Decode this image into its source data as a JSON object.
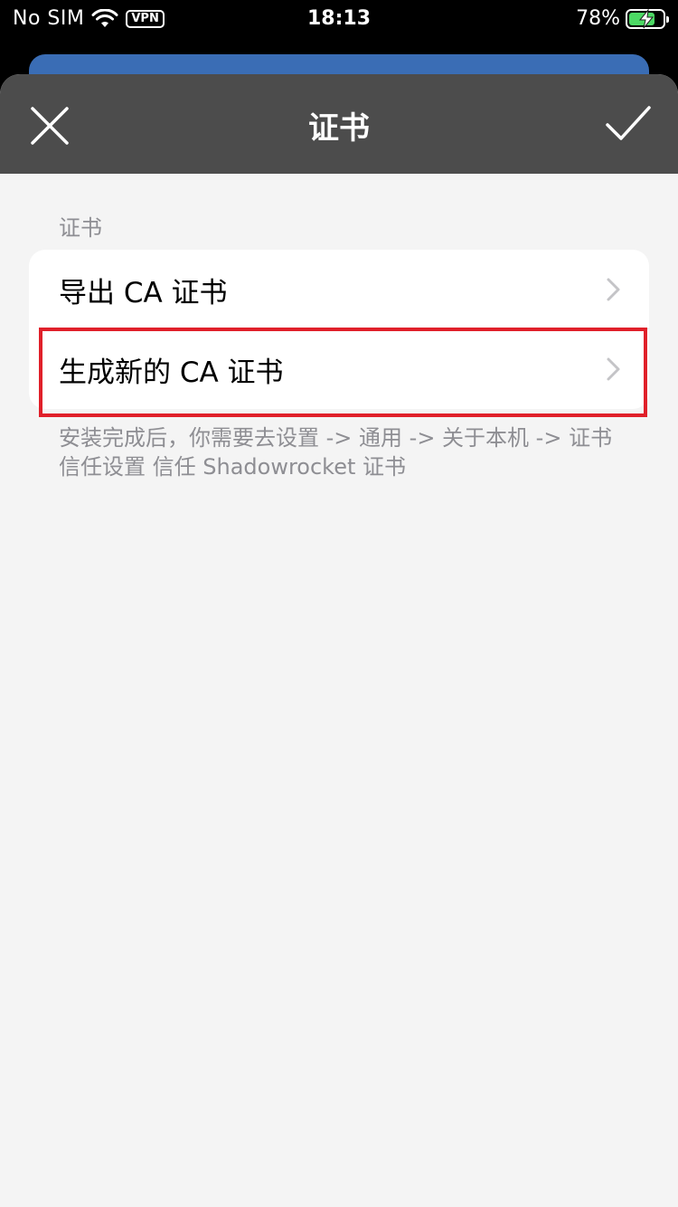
{
  "status_bar": {
    "carrier": "No SIM",
    "vpn": "VPN",
    "time": "18:13",
    "battery": "78%",
    "battery_level": 0.78,
    "battery_color": "#4cd964"
  },
  "nav": {
    "title": "证书",
    "close_icon": "close-icon",
    "done_icon": "checkmark-icon",
    "background": "#4c4c4c"
  },
  "section": {
    "header": "证书",
    "rows": [
      {
        "label": "导出 CA 证书",
        "icon": "chevron-right-icon"
      },
      {
        "label": "生成新的 CA 证书",
        "icon": "chevron-right-icon",
        "highlighted": true
      }
    ],
    "footer": "安装完成后，你需要去设置 -> 通用 -> 关于本机 -> 证书信任设置 信任 Shadowrocket 证书"
  },
  "colors": {
    "highlight": "#e0202a",
    "back_card": "#3a6db5"
  }
}
